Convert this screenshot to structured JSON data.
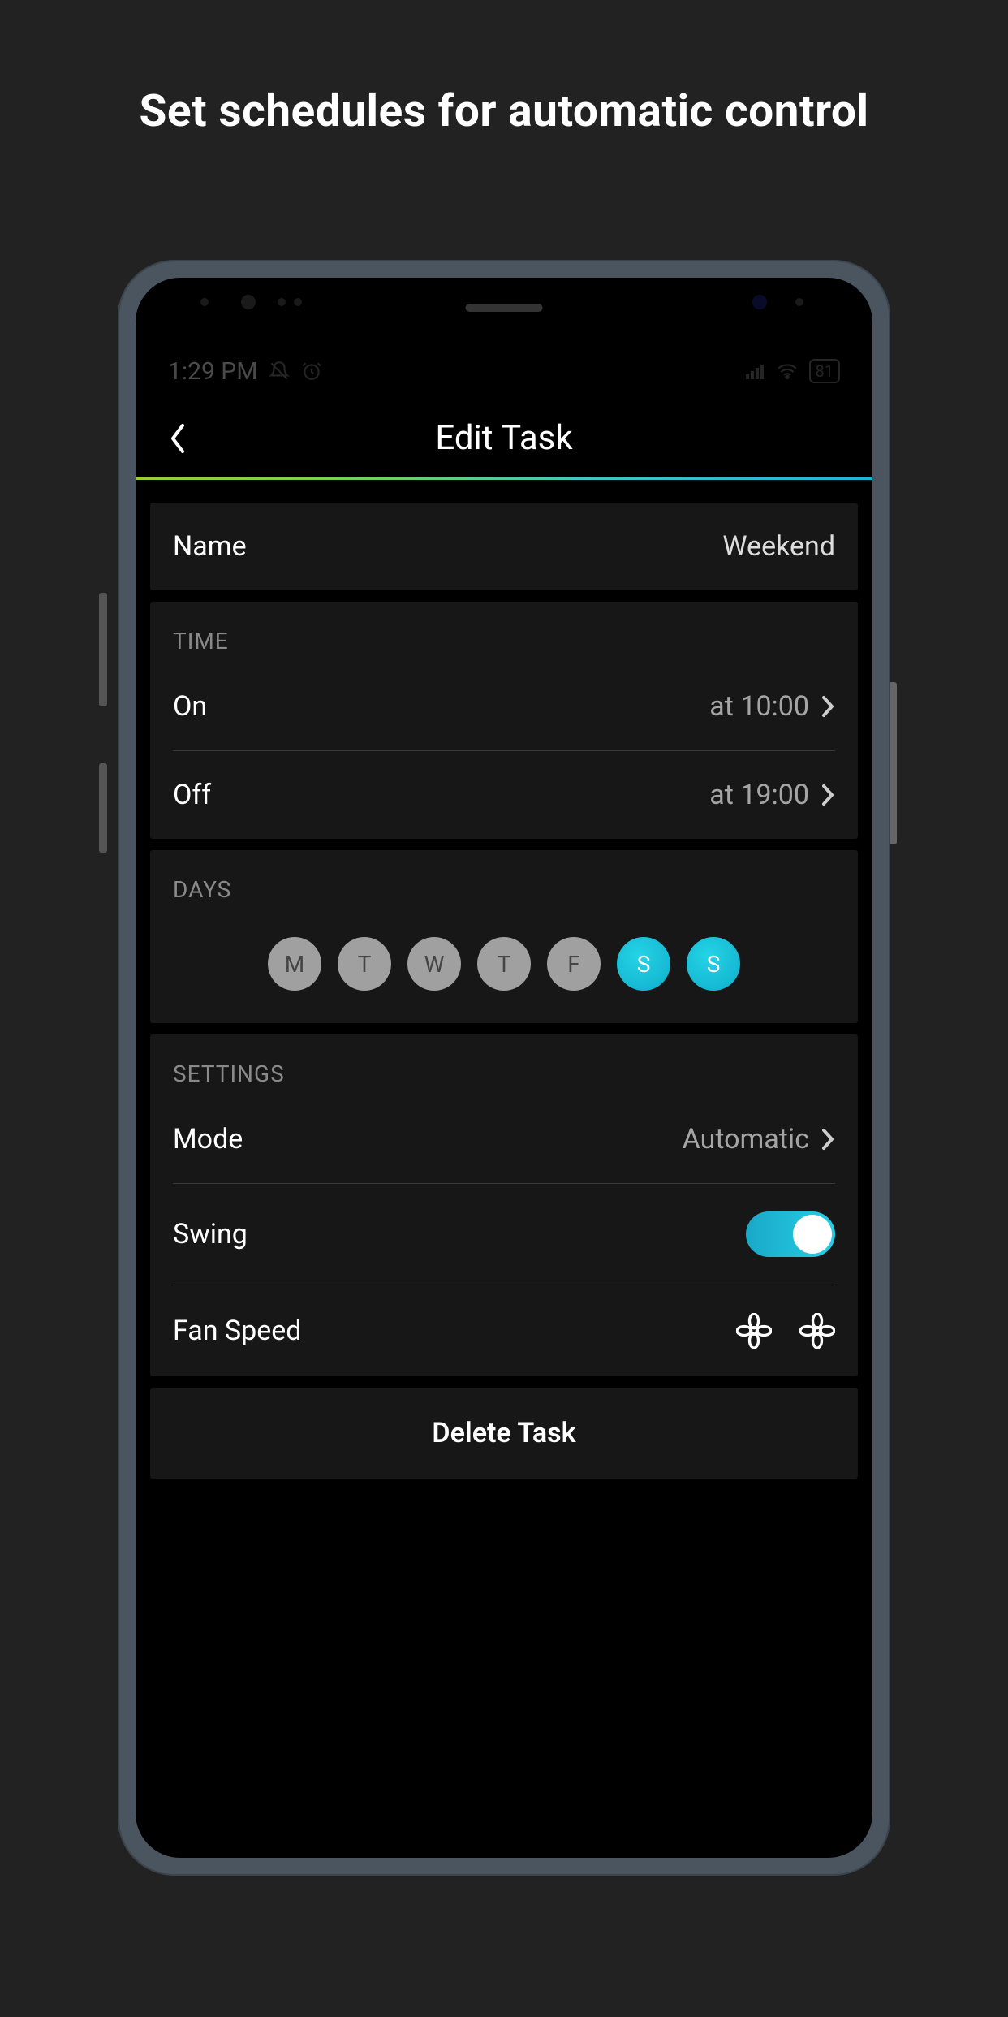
{
  "promo_title": "Set schedules for automatic control",
  "status_bar": {
    "time": "1:29 PM",
    "battery": "81"
  },
  "header": {
    "title": "Edit Task"
  },
  "name_row": {
    "label": "Name",
    "value": "Weekend"
  },
  "time_section": {
    "title": "TIME",
    "on": {
      "label": "On",
      "value": "at 10:00"
    },
    "off": {
      "label": "Off",
      "value": "at 19:00"
    }
  },
  "days_section": {
    "title": "DAYS",
    "days": [
      {
        "letter": "M",
        "active": false
      },
      {
        "letter": "T",
        "active": false
      },
      {
        "letter": "W",
        "active": false
      },
      {
        "letter": "T",
        "active": false
      },
      {
        "letter": "F",
        "active": false
      },
      {
        "letter": "S",
        "active": true
      },
      {
        "letter": "S",
        "active": true
      }
    ]
  },
  "settings_section": {
    "title": "SETTINGS",
    "mode": {
      "label": "Mode",
      "value": "Automatic"
    },
    "swing": {
      "label": "Swing",
      "on": true
    },
    "fan_speed": {
      "label": "Fan Speed"
    }
  },
  "delete_label": "Delete Task"
}
